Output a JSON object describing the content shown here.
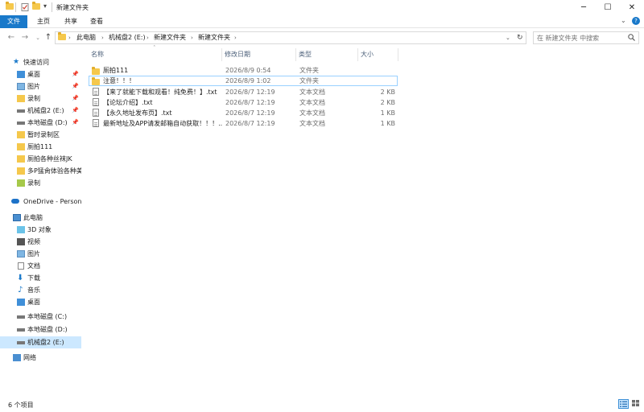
{
  "window": {
    "title": "新建文件夹"
  },
  "ribbon": {
    "tabs": [
      "文件",
      "主页",
      "共享",
      "查看"
    ]
  },
  "address": {
    "crumbs": [
      "此电脑",
      "机械盘2 (E:)",
      "新建文件夹",
      "新建文件夹"
    ]
  },
  "search": {
    "placeholder": "在 新建文件夹 中搜索"
  },
  "sidebar": {
    "quick_access": "快速访问",
    "quick_items": [
      "桌面",
      "图片",
      "录制",
      "机械盘2 (E:)",
      "本地磁盘 (D:)",
      "暂时录制区",
      "厕拍111",
      "厕拍各种丝袜JK",
      "多P猛肏体验各种美",
      "录制"
    ],
    "onedrive": "OneDrive - Persona",
    "this_pc": "此电脑",
    "pc_items": [
      "3D 对象",
      "视频",
      "图片",
      "文档",
      "下载",
      "音乐",
      "桌面",
      "本地磁盘 (C:)",
      "本地磁盘 (D:)",
      "机械盘2 (E:)"
    ],
    "network": "网络"
  },
  "columns": {
    "name": "名称",
    "date": "修改日期",
    "type": "类型",
    "size": "大小"
  },
  "files": [
    {
      "name": "厕拍111",
      "date": "2026/8/9 0:54",
      "type": "文件夹",
      "size": "",
      "kind": "folder"
    },
    {
      "name": "注意！！！",
      "date": "2026/8/9 1:02",
      "type": "文件夹",
      "size": "",
      "kind": "folder"
    },
    {
      "name": "【来了就能下载和观看！纯免费！】.txt",
      "date": "2026/8/7 12:19",
      "type": "文本文档",
      "size": "2 KB",
      "kind": "txt"
    },
    {
      "name": "【论坛介绍】.txt",
      "date": "2026/8/7 12:19",
      "type": "文本文档",
      "size": "2 KB",
      "kind": "txt"
    },
    {
      "name": "【永久地址发布页】.txt",
      "date": "2026/8/7 12:19",
      "type": "文本文档",
      "size": "1 KB",
      "kind": "txt"
    },
    {
      "name": "最新地址及APP请发邮箱自动获取！！！....",
      "date": "2026/8/7 12:19",
      "type": "文本文档",
      "size": "1 KB",
      "kind": "txt"
    }
  ],
  "status": {
    "count": "6 个项目"
  },
  "colors": {
    "accent": "#1979ca",
    "folder": "#f5c84c",
    "selection": "#cce8ff"
  }
}
